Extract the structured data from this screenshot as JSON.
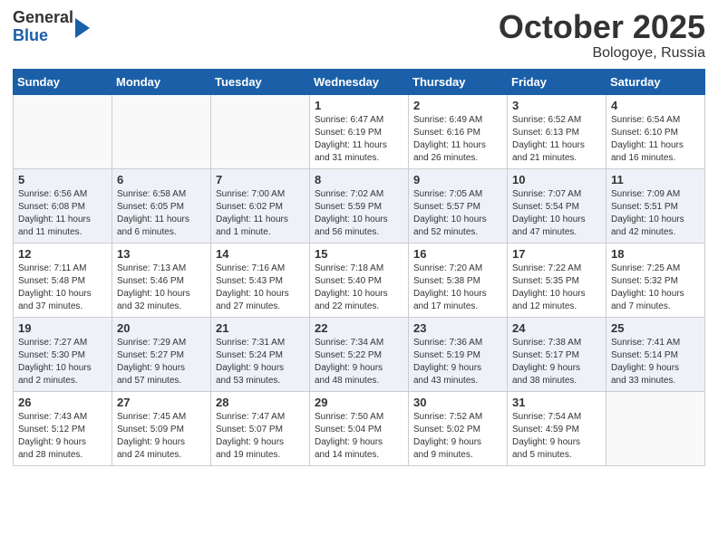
{
  "header": {
    "logo_general": "General",
    "logo_blue": "Blue",
    "month": "October 2025",
    "location": "Bologoye, Russia"
  },
  "days_of_week": [
    "Sunday",
    "Monday",
    "Tuesday",
    "Wednesday",
    "Thursday",
    "Friday",
    "Saturday"
  ],
  "weeks": [
    [
      {
        "day": "",
        "info": ""
      },
      {
        "day": "",
        "info": ""
      },
      {
        "day": "",
        "info": ""
      },
      {
        "day": "1",
        "info": "Sunrise: 6:47 AM\nSunset: 6:19 PM\nDaylight: 11 hours\nand 31 minutes."
      },
      {
        "day": "2",
        "info": "Sunrise: 6:49 AM\nSunset: 6:16 PM\nDaylight: 11 hours\nand 26 minutes."
      },
      {
        "day": "3",
        "info": "Sunrise: 6:52 AM\nSunset: 6:13 PM\nDaylight: 11 hours\nand 21 minutes."
      },
      {
        "day": "4",
        "info": "Sunrise: 6:54 AM\nSunset: 6:10 PM\nDaylight: 11 hours\nand 16 minutes."
      }
    ],
    [
      {
        "day": "5",
        "info": "Sunrise: 6:56 AM\nSunset: 6:08 PM\nDaylight: 11 hours\nand 11 minutes."
      },
      {
        "day": "6",
        "info": "Sunrise: 6:58 AM\nSunset: 6:05 PM\nDaylight: 11 hours\nand 6 minutes."
      },
      {
        "day": "7",
        "info": "Sunrise: 7:00 AM\nSunset: 6:02 PM\nDaylight: 11 hours\nand 1 minute."
      },
      {
        "day": "8",
        "info": "Sunrise: 7:02 AM\nSunset: 5:59 PM\nDaylight: 10 hours\nand 56 minutes."
      },
      {
        "day": "9",
        "info": "Sunrise: 7:05 AM\nSunset: 5:57 PM\nDaylight: 10 hours\nand 52 minutes."
      },
      {
        "day": "10",
        "info": "Sunrise: 7:07 AM\nSunset: 5:54 PM\nDaylight: 10 hours\nand 47 minutes."
      },
      {
        "day": "11",
        "info": "Sunrise: 7:09 AM\nSunset: 5:51 PM\nDaylight: 10 hours\nand 42 minutes."
      }
    ],
    [
      {
        "day": "12",
        "info": "Sunrise: 7:11 AM\nSunset: 5:48 PM\nDaylight: 10 hours\nand 37 minutes."
      },
      {
        "day": "13",
        "info": "Sunrise: 7:13 AM\nSunset: 5:46 PM\nDaylight: 10 hours\nand 32 minutes."
      },
      {
        "day": "14",
        "info": "Sunrise: 7:16 AM\nSunset: 5:43 PM\nDaylight: 10 hours\nand 27 minutes."
      },
      {
        "day": "15",
        "info": "Sunrise: 7:18 AM\nSunset: 5:40 PM\nDaylight: 10 hours\nand 22 minutes."
      },
      {
        "day": "16",
        "info": "Sunrise: 7:20 AM\nSunset: 5:38 PM\nDaylight: 10 hours\nand 17 minutes."
      },
      {
        "day": "17",
        "info": "Sunrise: 7:22 AM\nSunset: 5:35 PM\nDaylight: 10 hours\nand 12 minutes."
      },
      {
        "day": "18",
        "info": "Sunrise: 7:25 AM\nSunset: 5:32 PM\nDaylight: 10 hours\nand 7 minutes."
      }
    ],
    [
      {
        "day": "19",
        "info": "Sunrise: 7:27 AM\nSunset: 5:30 PM\nDaylight: 10 hours\nand 2 minutes."
      },
      {
        "day": "20",
        "info": "Sunrise: 7:29 AM\nSunset: 5:27 PM\nDaylight: 9 hours\nand 57 minutes."
      },
      {
        "day": "21",
        "info": "Sunrise: 7:31 AM\nSunset: 5:24 PM\nDaylight: 9 hours\nand 53 minutes."
      },
      {
        "day": "22",
        "info": "Sunrise: 7:34 AM\nSunset: 5:22 PM\nDaylight: 9 hours\nand 48 minutes."
      },
      {
        "day": "23",
        "info": "Sunrise: 7:36 AM\nSunset: 5:19 PM\nDaylight: 9 hours\nand 43 minutes."
      },
      {
        "day": "24",
        "info": "Sunrise: 7:38 AM\nSunset: 5:17 PM\nDaylight: 9 hours\nand 38 minutes."
      },
      {
        "day": "25",
        "info": "Sunrise: 7:41 AM\nSunset: 5:14 PM\nDaylight: 9 hours\nand 33 minutes."
      }
    ],
    [
      {
        "day": "26",
        "info": "Sunrise: 7:43 AM\nSunset: 5:12 PM\nDaylight: 9 hours\nand 28 minutes."
      },
      {
        "day": "27",
        "info": "Sunrise: 7:45 AM\nSunset: 5:09 PM\nDaylight: 9 hours\nand 24 minutes."
      },
      {
        "day": "28",
        "info": "Sunrise: 7:47 AM\nSunset: 5:07 PM\nDaylight: 9 hours\nand 19 minutes."
      },
      {
        "day": "29",
        "info": "Sunrise: 7:50 AM\nSunset: 5:04 PM\nDaylight: 9 hours\nand 14 minutes."
      },
      {
        "day": "30",
        "info": "Sunrise: 7:52 AM\nSunset: 5:02 PM\nDaylight: 9 hours\nand 9 minutes."
      },
      {
        "day": "31",
        "info": "Sunrise: 7:54 AM\nSunset: 4:59 PM\nDaylight: 9 hours\nand 5 minutes."
      },
      {
        "day": "",
        "info": ""
      }
    ]
  ]
}
